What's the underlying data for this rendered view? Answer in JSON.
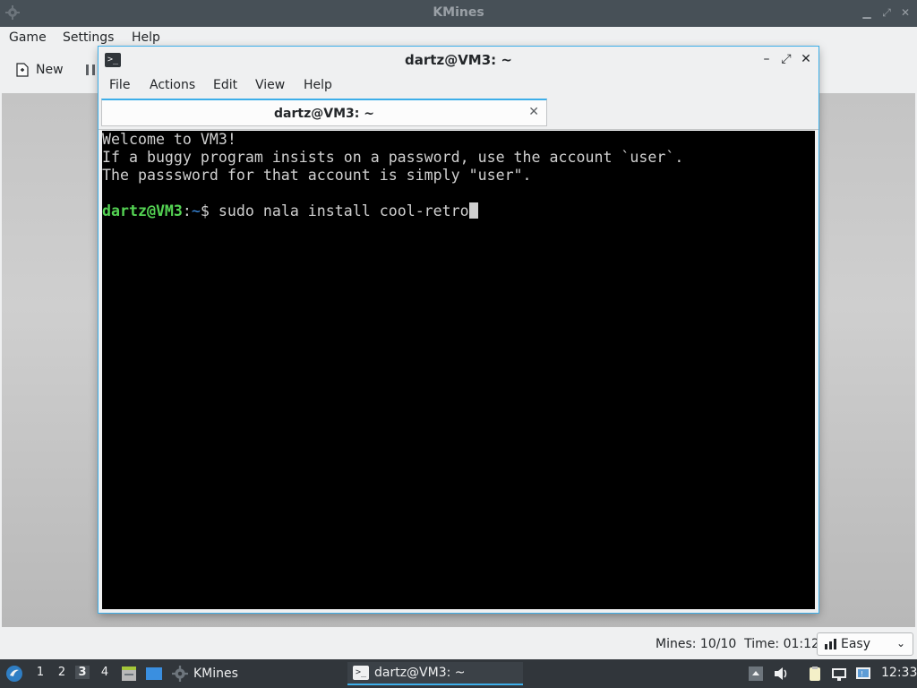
{
  "kmines": {
    "title": "KMines",
    "menu": [
      "Game",
      "Settings",
      "Help"
    ],
    "toolbar": {
      "new_label": "New"
    },
    "status": {
      "mines_text": "Mines: 10/10",
      "time_text": "Time: 01:12"
    },
    "difficulty": "Easy"
  },
  "terminal": {
    "title": "dartz@VM3: ~",
    "menu": [
      "File",
      "Actions",
      "Edit",
      "View",
      "Help"
    ],
    "tab_label": "dartz@VM3: ~",
    "lines": [
      "Welcome to VM3!",
      "If a buggy program insists on a password, use the account `user`.",
      "The passsword for that account is simply \"user\".",
      ""
    ],
    "prompt": {
      "user_host": "dartz@VM3",
      "sep": ":",
      "path": "~",
      "symbol": "$ ",
      "command": "sudo nala install cool-retro"
    }
  },
  "taskbar": {
    "desktops": [
      "1",
      "2",
      "3",
      "4"
    ],
    "active_desktop": "3",
    "tasks": [
      {
        "label": "KMines",
        "icon": "gear-icon"
      },
      {
        "label": "dartz@VM3: ~",
        "icon": "terminal-icon"
      }
    ],
    "clock": "12:33"
  },
  "colors": {
    "accent": "#3daee9",
    "prompt_user": "#54d353",
    "prompt_path": "#3b8ee6",
    "panel": "#31363b"
  }
}
